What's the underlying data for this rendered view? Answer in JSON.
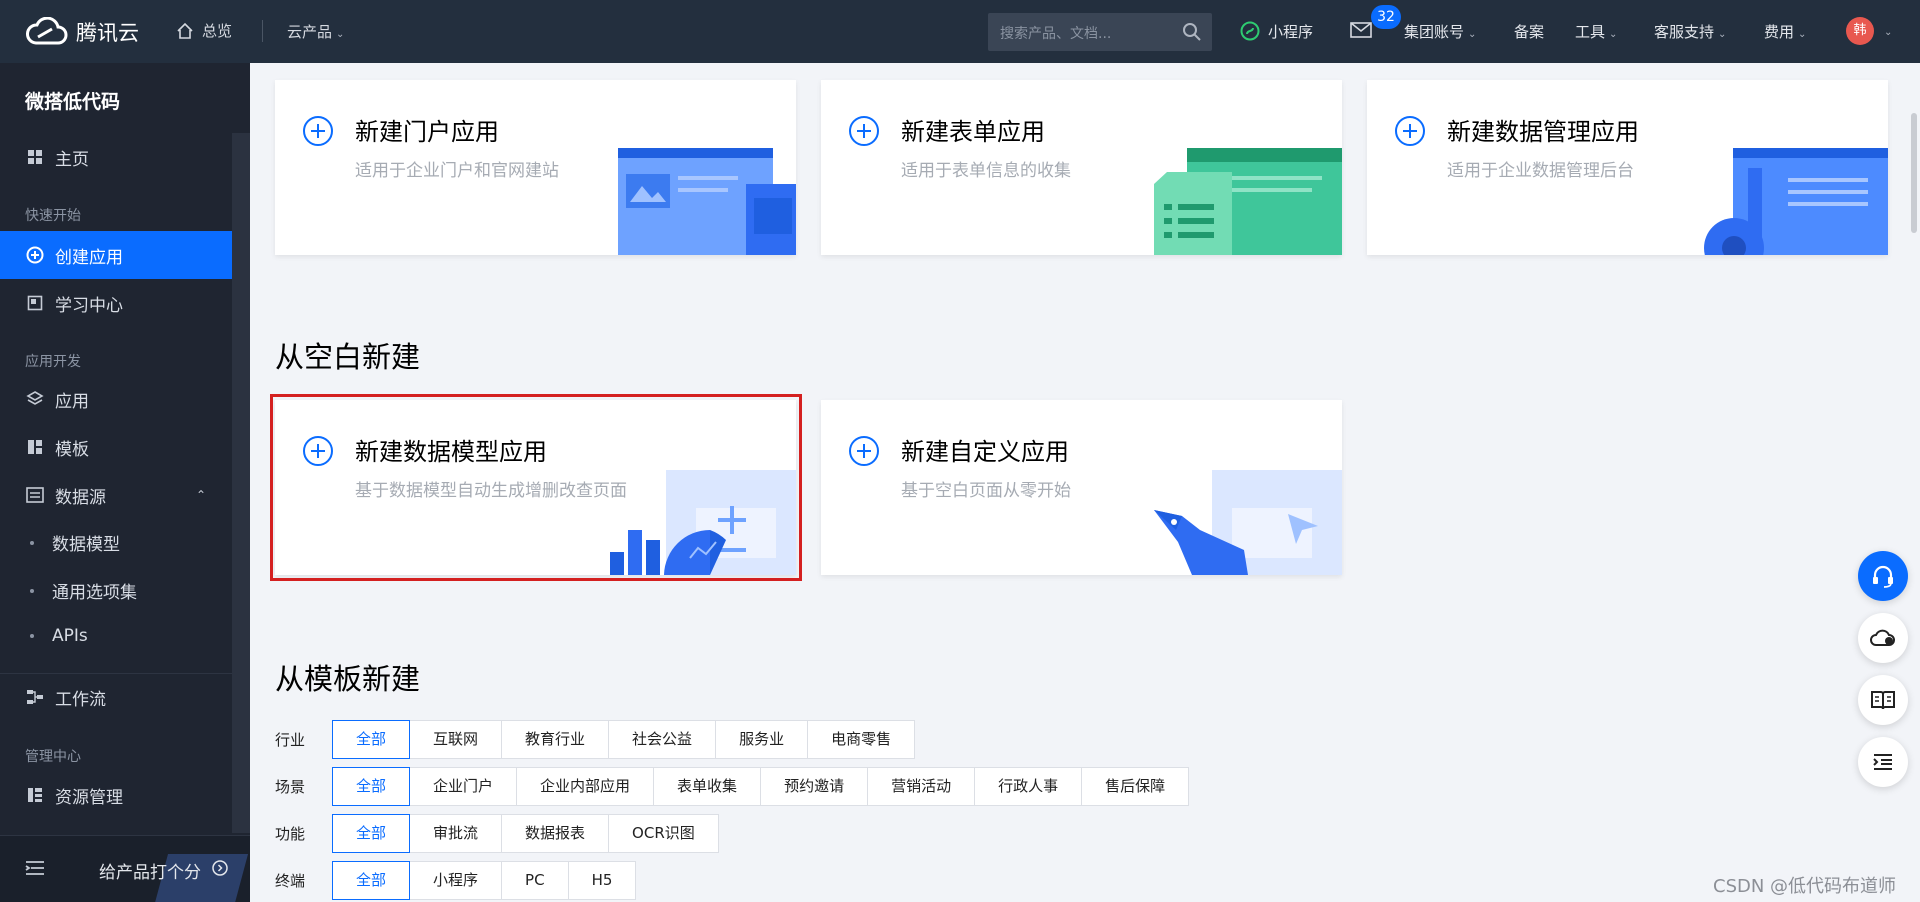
{
  "topbar": {
    "logo_text": "腾讯云",
    "home": "总览",
    "products": "云产品",
    "search_placeholder": "搜索产品、文档...",
    "miniprogram": "小程序",
    "mail_badge": "32",
    "group_account": "集团账号",
    "beian": "备案",
    "tools": "工具",
    "support": "客服支持",
    "fees": "费用",
    "avatar": "韩"
  },
  "sidebar": {
    "title": "微搭低代码",
    "home": "主页",
    "section_quickstart": "快速开始",
    "create_app": "创建应用",
    "learning": "学习中心",
    "section_dev": "应用开发",
    "apps": "应用",
    "templates": "模板",
    "datasource": "数据源",
    "data_model": "数据模型",
    "option_sets": "通用选项集",
    "apis": "APIs",
    "workflow": "工作流",
    "section_admin": "管理中心",
    "resources": "资源管理",
    "rate": "给产品打个分"
  },
  "cards_top": [
    {
      "title": "新建门户应用",
      "desc": "适用于企业门户和官网建站"
    },
    {
      "title": "新建表单应用",
      "desc": "适用于表单信息的收集"
    },
    {
      "title": "新建数据管理应用",
      "desc": "适用于企业数据管理后台"
    }
  ],
  "section_blank": "从空白新建",
  "cards_blank": [
    {
      "title": "新建数据模型应用",
      "desc": "基于数据模型自动生成增删改查页面"
    },
    {
      "title": "新建自定义应用",
      "desc": "基于空白页面从零开始"
    }
  ],
  "section_template": "从模板新建",
  "filters": {
    "industry": {
      "label": "行业",
      "options": [
        "全部",
        "互联网",
        "教育行业",
        "社会公益",
        "服务业",
        "电商零售"
      ]
    },
    "scene": {
      "label": "场景",
      "options": [
        "全部",
        "企业门户",
        "企业内部应用",
        "表单收集",
        "预约邀请",
        "营销活动",
        "行政人事",
        "售后保障"
      ]
    },
    "feature": {
      "label": "功能",
      "options": [
        "全部",
        "审批流",
        "数据报表",
        "OCR识图"
      ]
    },
    "terminal": {
      "label": "终端",
      "options": [
        "全部",
        "小程序",
        "PC",
        "H5"
      ]
    }
  },
  "watermark": "CSDN @低代码布道师",
  "colors": {
    "primary": "#0a6cff",
    "topbar": "#232f3e",
    "sidebar": "#1f2531",
    "highlight": "#d42020"
  }
}
